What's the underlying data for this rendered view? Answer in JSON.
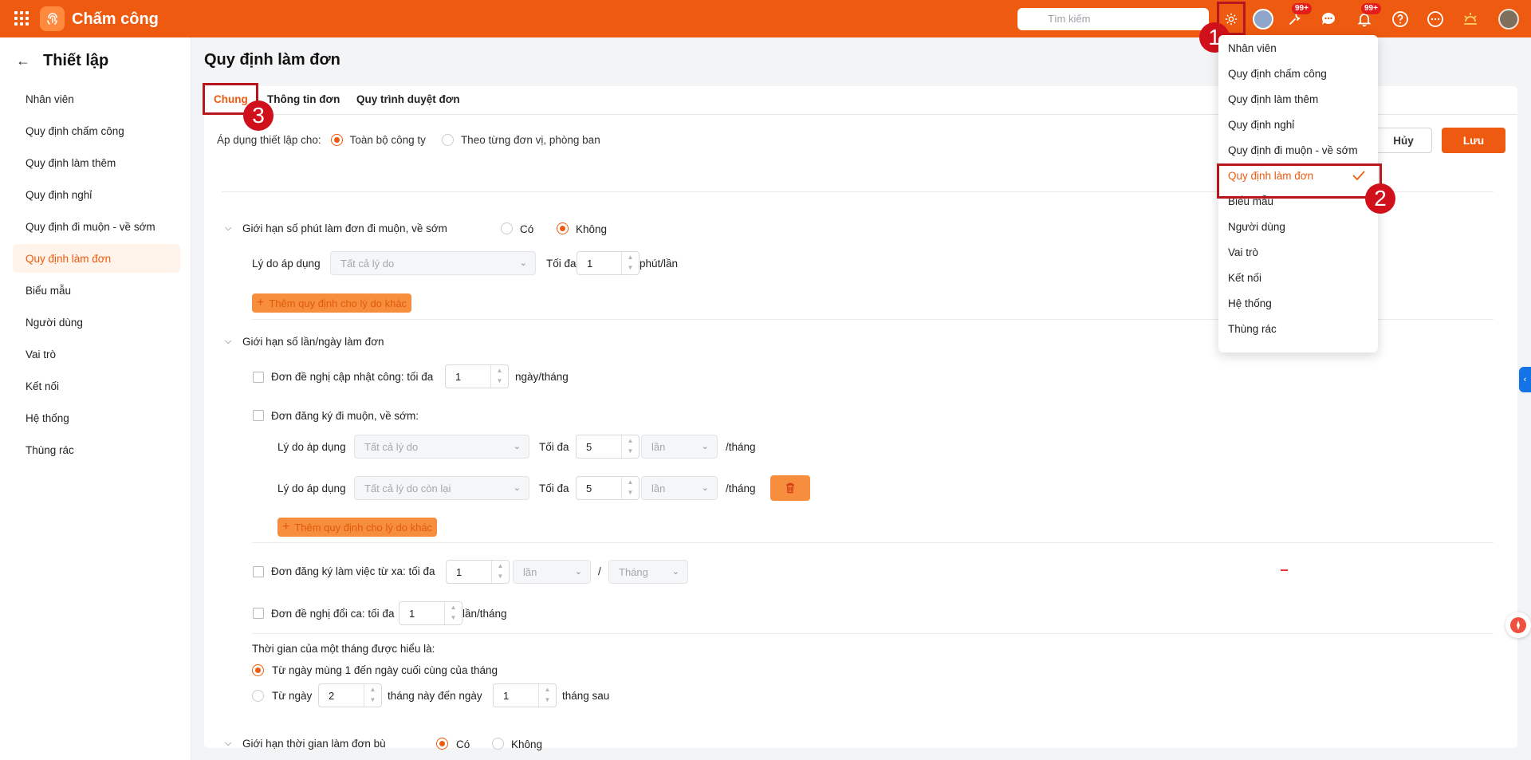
{
  "app": {
    "title": "Chấm công"
  },
  "search": {
    "placeholder": "Tìm kiếm"
  },
  "badges": {
    "tasks": "99+",
    "notifications": "99+"
  },
  "markers": {
    "one": "1",
    "two": "2",
    "three": "3"
  },
  "sidebar": {
    "title": "Thiết lập",
    "items": [
      {
        "label": "Nhân viên"
      },
      {
        "label": "Quy định chấm công"
      },
      {
        "label": "Quy định làm thêm"
      },
      {
        "label": "Quy định nghỉ"
      },
      {
        "label": "Quy định đi muộn - về sớm"
      },
      {
        "label": "Quy định làm đơn",
        "active": true
      },
      {
        "label": "Biểu mẫu"
      },
      {
        "label": "Người dùng"
      },
      {
        "label": "Vai trò"
      },
      {
        "label": "Kết nối"
      },
      {
        "label": "Hệ thống"
      },
      {
        "label": "Thùng rác"
      }
    ]
  },
  "page": {
    "title": "Quy định làm đơn"
  },
  "tabs": [
    "Chung",
    "Thông tin đơn",
    "Quy trình duyệt đơn"
  ],
  "apply": {
    "label": "Áp dụng thiết lập cho:",
    "option_all": "Toàn bộ công ty",
    "option_unit": "Theo từng đơn vị, phòng ban",
    "selected": "option_all"
  },
  "actions": {
    "cancel": "Hủy",
    "save": "Lưu"
  },
  "late_limit": {
    "title": "Giới hạn số phút làm đơn đi muộn, về sớm",
    "yes": "Có",
    "no": "Không",
    "selected": "no",
    "reason_label": "Lý do áp dụng",
    "reason_value": "Tất cả lý do",
    "max_label": "Tối đa",
    "max_value": "1",
    "unit": "phút/lần",
    "add_button": "Thêm quy định cho lý do khác"
  },
  "count_limit": {
    "title": "Giới hạn số lần/ngày làm đơn",
    "update_request": {
      "label": "Đơn đề nghị cập nhật công: tối đa",
      "value": "1",
      "unit": "ngày/tháng",
      "checked": false
    },
    "late_request": {
      "label": "Đơn đăng ký đi muộn, về sớm:",
      "checked": false,
      "rows": [
        {
          "reason_label": "Lý do áp dụng",
          "reason_value": "Tất cả lý do",
          "max_label": "Tối đa",
          "value": "5",
          "unit_select": "lần",
          "per": "/tháng"
        },
        {
          "reason_label": "Lý do áp dụng",
          "reason_value": "Tất cả lý do còn lại",
          "max_label": "Tối đa",
          "value": "5",
          "unit_select": "lần",
          "per": "/tháng"
        }
      ],
      "add_button": "Thêm quy định cho lý do khác"
    },
    "remote_request": {
      "label": "Đơn đăng ký làm việc từ xa: tối đa",
      "value": "1",
      "unit_select": "lần",
      "slash": "/",
      "period_select": "Tháng",
      "checked": false
    },
    "shift_request": {
      "label": "Đơn đề nghị đổi ca: tối đa",
      "value": "1",
      "unit": "lần/tháng",
      "checked": false
    }
  },
  "month_def": {
    "title": "Thời gian của một tháng được hiểu là:",
    "option1": "Từ ngày mùng 1 đến ngày cuối cùng của tháng",
    "option2_prefix": "Từ ngày",
    "option2_from": "2",
    "option2_mid": "tháng này đến ngày",
    "option2_to": "1",
    "option2_suffix": "tháng sau",
    "selected": "option1"
  },
  "makeup_limit": {
    "title": "Giới hạn thời gian làm đơn bù",
    "yes": "Có",
    "no": "Không",
    "selected": "yes"
  },
  "settings_menu": {
    "items": [
      {
        "label": "Nhân viên"
      },
      {
        "label": "Quy định chấm công"
      },
      {
        "label": "Quy định làm thêm"
      },
      {
        "label": "Quy định nghỉ"
      },
      {
        "label": "Quy định đi muộn - về sớm"
      },
      {
        "label": "Quy định làm đơn",
        "active": true
      },
      {
        "label": "Biểu mẫu"
      },
      {
        "label": "Người dùng"
      },
      {
        "label": "Vai trò"
      },
      {
        "label": "Kết nối"
      },
      {
        "label": "Hệ thống"
      },
      {
        "label": "Thùng rác"
      }
    ]
  },
  "colors": {
    "brand": "#ee5a0f",
    "highlight": "#b8161e",
    "marker": "#d0101a"
  }
}
